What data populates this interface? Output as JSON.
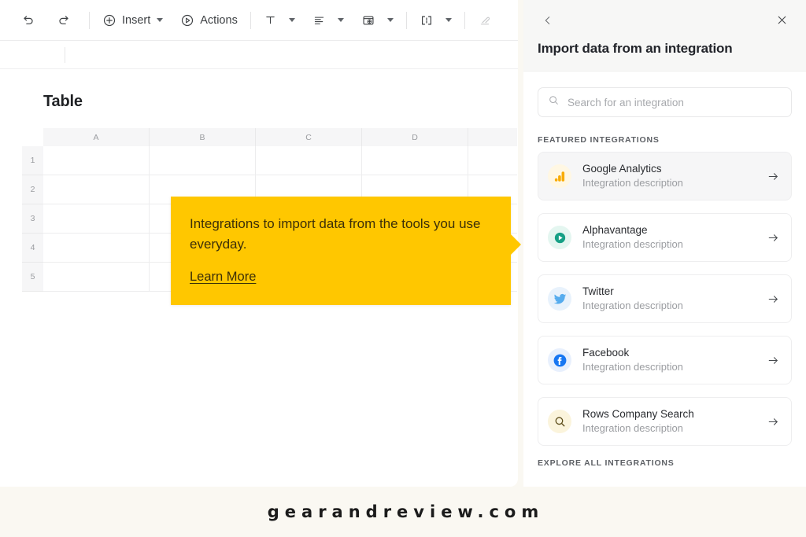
{
  "toolbar": {
    "undo_label": "",
    "redo_label": "",
    "insert_label": "Insert",
    "actions_label": "Actions",
    "text_label": "",
    "align_label": "",
    "image_label": "",
    "layout_label": "",
    "eraser_label": "",
    "icons": {
      "undo": "undo-arrow-icon",
      "redo": "redo-arrow-icon",
      "insert": "plus-circle-icon",
      "actions": "play-circle-icon",
      "text": "text-format-icon",
      "align": "align-left-icon",
      "image": "image-frame-icon",
      "layout": "layout-columns-icon",
      "eraser": "eraser-icon"
    }
  },
  "document": {
    "table_title": "Table",
    "columns": [
      "A",
      "B",
      "C",
      "D",
      ""
    ],
    "rows": [
      "1",
      "2",
      "3",
      "4",
      "5"
    ]
  },
  "callout": {
    "text": "Integrations to import data from the tools you use everyday.",
    "link_label": "Learn More",
    "background_color": "#FFC700",
    "text_color": "#3C2F08"
  },
  "panel": {
    "back_icon": "chevron-left-icon",
    "close_icon": "close-x-icon",
    "title": "Import data from an integration",
    "search": {
      "placeholder": "Search for an integration",
      "value": "",
      "icon": "search-icon"
    },
    "featured_label": "FEATURED INTEGRATIONS",
    "explore_label": "EXPLORE ALL INTEGRATIONS",
    "integrations": [
      {
        "name": "Google Analytics",
        "description": "Integration description",
        "icon": "google-analytics-icon",
        "icon_bg": "#FFF7E3",
        "accent": "#F9AB00",
        "highlighted": true
      },
      {
        "name": "Alphavantage",
        "description": "Integration description",
        "icon": "alphavantage-play-icon",
        "icon_bg": "#E4F6F0",
        "accent": "#16A085",
        "highlighted": false
      },
      {
        "name": "Twitter",
        "description": "Integration description",
        "icon": "twitter-bird-icon",
        "icon_bg": "#E8F2FC",
        "accent": "#56ACEE",
        "highlighted": false
      },
      {
        "name": "Facebook",
        "description": "Integration description",
        "icon": "facebook-f-icon",
        "icon_bg": "#E8F0FD",
        "accent": "#1877F2",
        "highlighted": false
      },
      {
        "name": "Rows Company Search",
        "description": "Integration description",
        "icon": "magnifier-icon",
        "icon_bg": "#FBF4DC",
        "accent": "#5B4B18",
        "highlighted": false
      }
    ],
    "arrow_icon": "arrow-right-icon"
  },
  "watermark": {
    "text": "gearandreview.com"
  }
}
